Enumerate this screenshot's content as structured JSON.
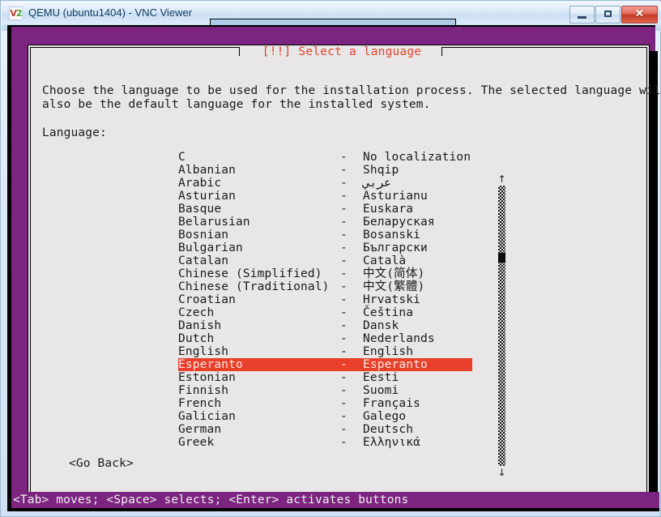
{
  "window": {
    "title": "QEMU (ubuntu1404) - VNC Viewer",
    "icon_v": "V",
    "icon_2": "2",
    "icon_name": "vnc-viewer-icon",
    "minimize_label": "",
    "maximize_label": "",
    "close_label": "✕"
  },
  "installer": {
    "dialog_title": "[!!] Select a language",
    "body_line1": "Choose the language to be used for the installation process. The selected language will",
    "body_line2": "also be the default language for the installed system.",
    "language_label": "Language:",
    "go_back": "<Go Back>",
    "help_bar": "<Tab> moves; <Space> selects; <Enter> activates buttons",
    "scroll_up_arrow": "↑",
    "scroll_down_arrow": "↓",
    "selected_index": 16,
    "separator": "-",
    "languages": [
      {
        "name": "C",
        "native": "No localization"
      },
      {
        "name": "Albanian",
        "native": "Shqip"
      },
      {
        "name": "Arabic",
        "native": "عربي"
      },
      {
        "name": "Asturian",
        "native": "Asturianu"
      },
      {
        "name": "Basque",
        "native": "Euskara"
      },
      {
        "name": "Belarusian",
        "native": "Беларуская"
      },
      {
        "name": "Bosnian",
        "native": "Bosanski"
      },
      {
        "name": "Bulgarian",
        "native": "Български"
      },
      {
        "name": "Catalan",
        "native": "Català"
      },
      {
        "name": "Chinese (Simplified)",
        "native": "中文(简体)"
      },
      {
        "name": "Chinese (Traditional)",
        "native": "中文(繁體)"
      },
      {
        "name": "Croatian",
        "native": "Hrvatski"
      },
      {
        "name": "Czech",
        "native": "Čeština"
      },
      {
        "name": "Danish",
        "native": "Dansk"
      },
      {
        "name": "Dutch",
        "native": "Nederlands"
      },
      {
        "name": "English",
        "native": "English"
      },
      {
        "name": "Esperanto",
        "native": "Esperanto"
      },
      {
        "name": "Estonian",
        "native": "Eesti"
      },
      {
        "name": "Finnish",
        "native": "Suomi"
      },
      {
        "name": "French",
        "native": "Français"
      },
      {
        "name": "Galician",
        "native": "Galego"
      },
      {
        "name": "German",
        "native": "Deutsch"
      },
      {
        "name": "Greek",
        "native": "Ελληνικά"
      }
    ]
  },
  "colors": {
    "ubuntu_purple": "#7c2580",
    "selection_red": "#e8402a",
    "title_red": "#e0462b",
    "dialog_bg": "#e8e6e6"
  }
}
